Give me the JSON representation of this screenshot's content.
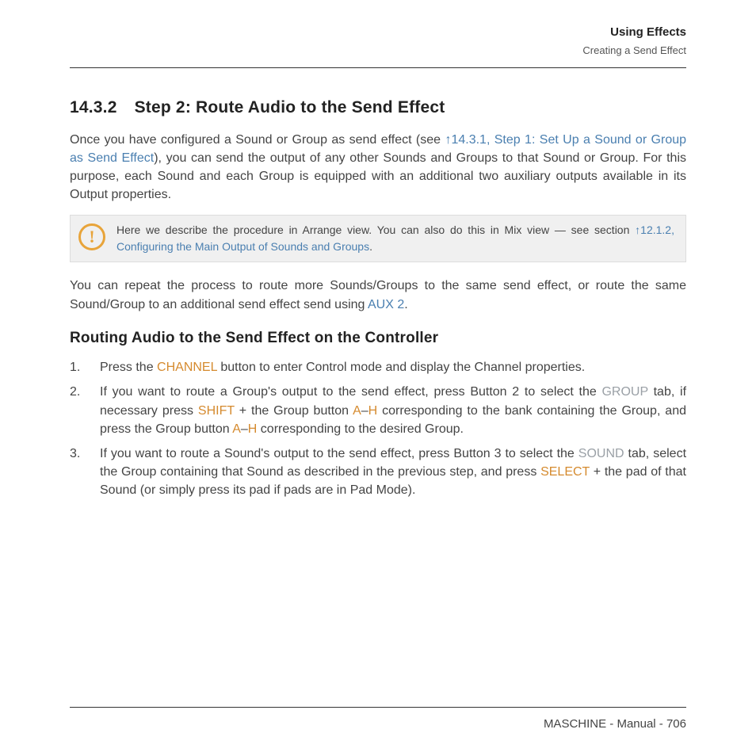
{
  "header": {
    "main": "Using Effects",
    "sub": "Creating a Send Effect"
  },
  "section": {
    "number": "14.3.2",
    "title": "Step 2: Route Audio to the Send Effect"
  },
  "para1": {
    "t1": "Once you have configured a Sound or Group as send effect (see ",
    "link1": "↑14.3.1, Step 1: Set Up a Sound or Group as Send Effect",
    "t2": "), you can send the output of any other Sounds and Groups to that Sound or Group. For this purpose, each Sound and each Group is equipped with an additional two auxiliary outputs available in its Output properties."
  },
  "callout": {
    "t1": "Here we describe the procedure in Arrange view. You can also do this in Mix view — see section ",
    "link": "↑12.1.2, Configuring the Main Output of Sounds and Groups",
    "t2": "."
  },
  "para2": {
    "t1": "You can repeat the process to route more Sounds/Groups to the same send effect, or route the same Sound/Group to an additional send effect send using ",
    "link": "AUX 2",
    "t2": "."
  },
  "subsection": "Routing Audio to the Send Effect on the Controller",
  "steps": {
    "s1": {
      "t1": "Press the ",
      "kw1": "CHANNEL",
      "t2": " button to enter Control mode and display the Channel properties."
    },
    "s2": {
      "t1": "If you want to route a Group's output to the send effect, press Button 2 to select the ",
      "kw1": "GROUP",
      "t2": " tab, if necessary press ",
      "kw2": "SHIFT",
      "t3": " + the Group button ",
      "kw3": "A",
      "t4": "–",
      "kw4": "H",
      "t5": " corresponding to the bank containing the Group, and press the Group button ",
      "kw5": "A",
      "t6": "–",
      "kw6": "H",
      "t7": " corresponding to the desired Group."
    },
    "s3": {
      "t1": "If you want to route a Sound's output to the send effect, press Button 3 to select the ",
      "kw1": "SOUND",
      "t2": " tab, select the Group containing that Sound as described in the previous step, and press ",
      "kw2": "SELECT",
      "t3": " + the pad of that Sound (or simply press its pad if pads are in Pad Mode)."
    }
  },
  "footer": "MASCHINE - Manual - 706"
}
